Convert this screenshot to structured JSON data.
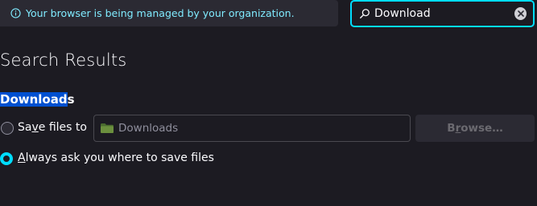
{
  "notice": {
    "text": "Your browser is being managed by your organization.",
    "icon": "info-icon",
    "color": "#80ebff"
  },
  "search": {
    "value": "Download",
    "icon": "search-icon",
    "clear_icon": "clear-icon",
    "accent": "#00ddff"
  },
  "page": {
    "title": "Search Results"
  },
  "downloads": {
    "heading_highlight": "Download",
    "heading_rest": "s",
    "save_files": {
      "label_prefix": "Sa",
      "label_accesskey": "v",
      "label_suffix": "e files to",
      "selected": false
    },
    "folder": {
      "value": "Downloads",
      "icon": "folder-icon"
    },
    "browse": {
      "label_prefix": "B",
      "label_accesskey": "r",
      "label_suffix": "owse…",
      "disabled": true
    },
    "always_ask": {
      "label_accesskey": "A",
      "label_suffix": "lways ask you where to save files",
      "selected": true
    }
  }
}
